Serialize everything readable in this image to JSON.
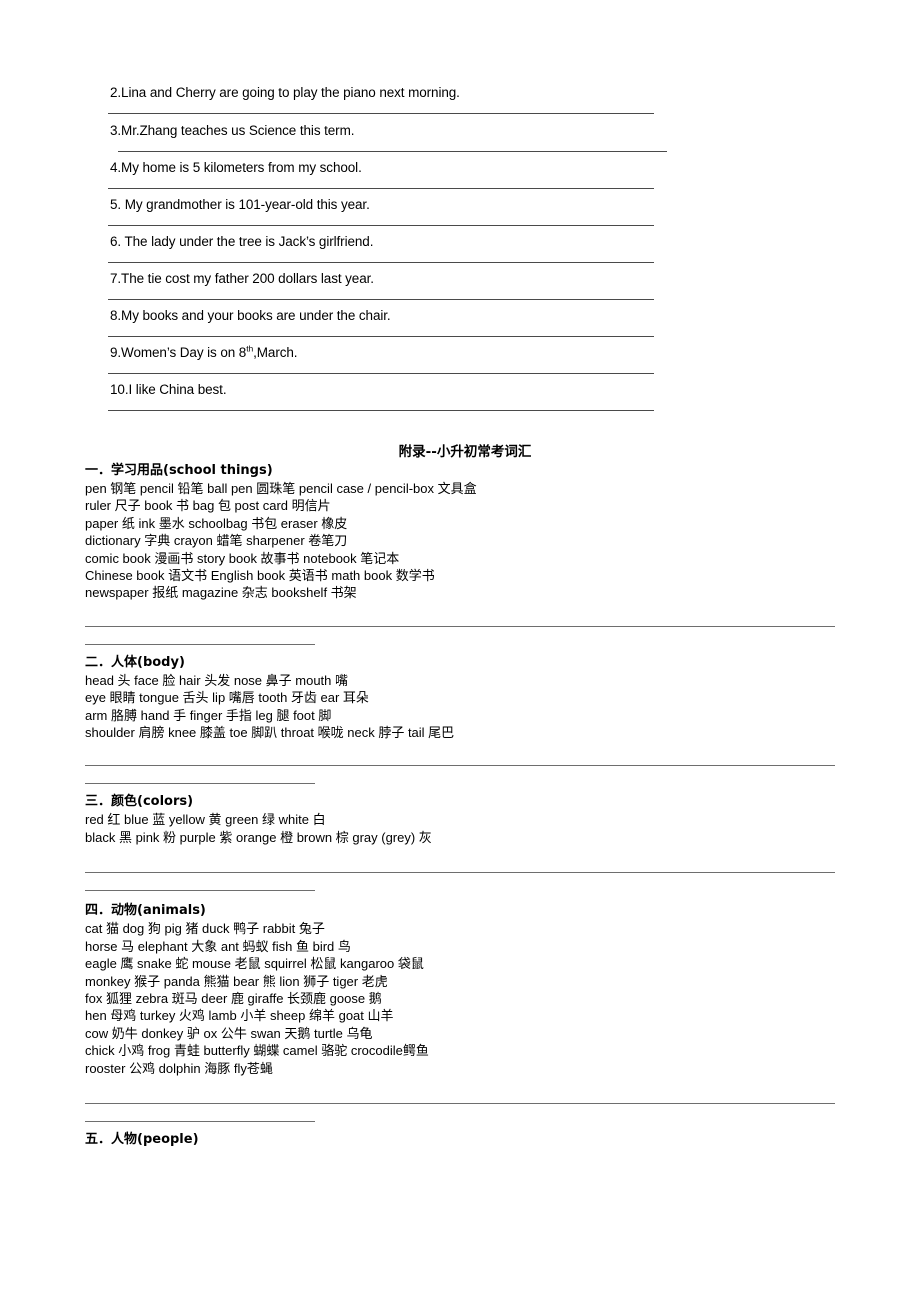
{
  "document": {
    "title": "附录--小升初常考词汇"
  },
  "sentences": [
    {
      "n": "2.",
      "text": "2.Lina and Cherry are going to play the piano next morning."
    },
    {
      "n": "3.",
      "text": "3.Mr.Zhang teaches us Science this term."
    },
    {
      "n": "4.",
      "text": "4.My home is 5 kilometers from my school."
    },
    {
      "n": "5.",
      "text": "5. My grandmother is 101-year-old this year."
    },
    {
      "n": "6.",
      "text": "6. The lady under the tree is Jack’s girlfriend."
    },
    {
      "n": "7.",
      "text": "7.The tie cost my father 200 dollars last year."
    },
    {
      "n": "8.",
      "text": "8.My books and your books are under the chair."
    },
    {
      "n": "9.",
      "pre": "9.Women’s Day is on 8",
      "sup": "th",
      "post": ",March."
    },
    {
      "n": "10.",
      "text": "10.I like China best."
    }
  ],
  "sections": [
    {
      "heading": "一．学习用品(school things)",
      "lines": [
        "pen    钢笔      pencil 铅笔     ball pen  圆珠笔      pencil case / pencil-box 文具盒",
        "ruler  尺子     book 书      bag     包        post card  明信片",
        "paper  纸     ink   墨水    schoolbag 书包      eraser 橡皮",
        "dictionary   字典     crayon      蜡笔      sharpener  卷笔刀",
        "comic book  漫画书   story book   故事书     notebook   笔记本",
        "Chinese book 语文书    English book 英语书      math book  数学书",
        "newspaper   报纸    magazine    杂志      bookshelf   书架"
      ]
    },
    {
      "heading": "二．人体(body)",
      "lines": [
        "head    头    face  脸    hair 头发     nose 鼻子     mouth 嘴",
        "eye     眼睛   tongue 舌头  lip  嘴唇     tooth 牙齿    ear  耳朵",
        "arm     胳膊   hand 手     finger 手指   leg  腿      foot   脚",
        "shoulder 肩膀   knee  膝盖  toe  脚趴    throat 喉咙    neck 脖子    tail 尾巴"
      ]
    },
    {
      "heading": "三．颜色(colors)",
      "lines": [
        "red     红     blue  蓝    yellow 黄    green  绿     white  白",
        "black   黑    pink  粉    purple 紫   orange  橙     brown 棕   gray (grey) 灰"
      ]
    },
    {
      "heading": "四．动物(animals)",
      "lines": [
        "cat     猫      dog    狗     pig   猪     duck   鸭子     rabbit  兔子",
        "horse   马     elephant 大象    ant  蚂蚁    fish  鱼      bird   鸟",
        "eagle   鹰    snake   蛇    mouse 老鼠    squirrel 松鼠    kangaroo 袋鼠",
        "monkey 猴子    panda  熊猫   bear  熊      lion  狮子    tiger   老虎",
        "fox    狐狸    zebra   斑马    deer  鹿      giraffe 长颈鹿     goose   鹅",
        "hen    母鸡    turkey  火鸡    lamb  小羊     sheep  绵羊     goat   山羊",
        "cow    奶牛    donkey  驴     ox   公牛     swan   天鹅    turtle  乌龟",
        "chick   小鸡    frog   青蛙    butterfly 蝴蝶    camel  骆驼     crocodile鳄鱼",
        "rooster 公鸡     dolphin 海豚     fly苍蝇"
      ]
    },
    {
      "heading": "五．人物(people)",
      "lines": []
    }
  ]
}
